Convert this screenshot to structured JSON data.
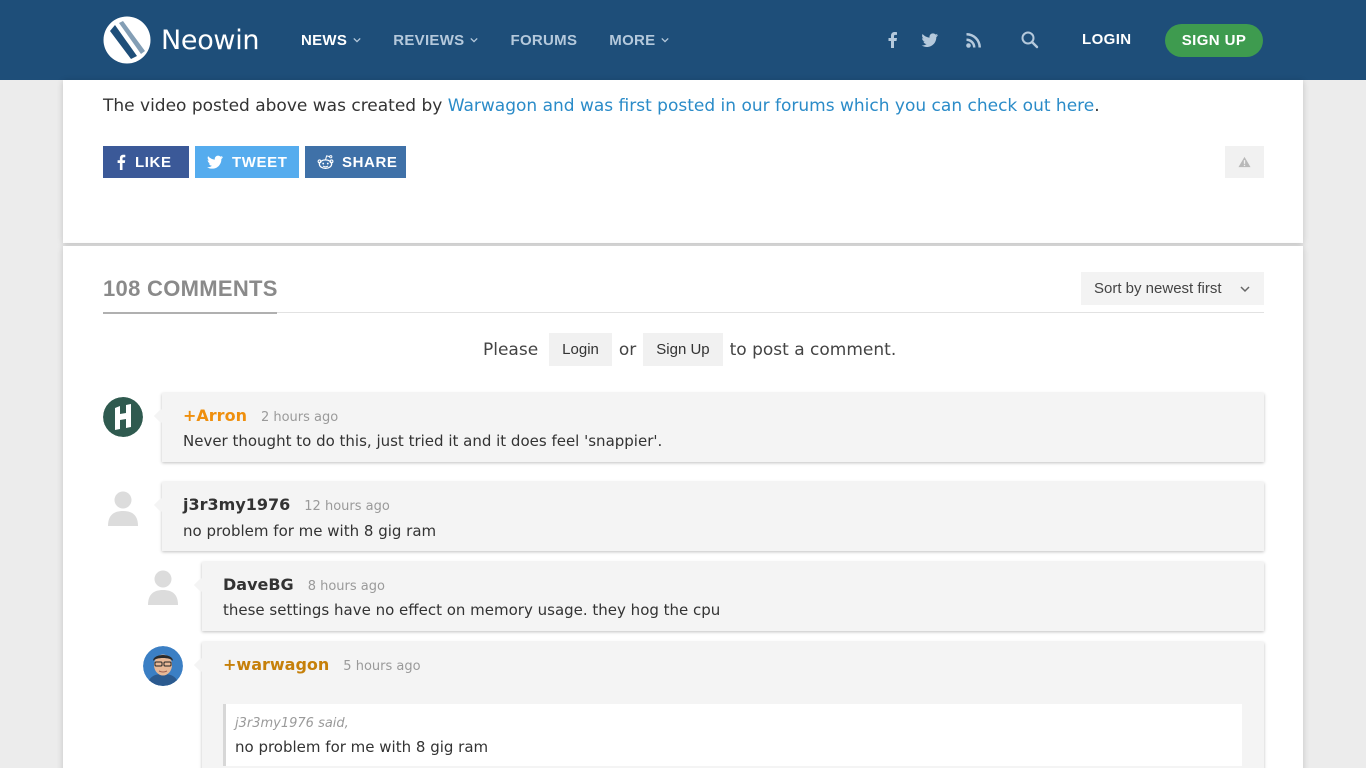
{
  "header": {
    "logo_text": "Neowin",
    "nav": [
      {
        "label": "NEWS",
        "active": true,
        "dropdown": true
      },
      {
        "label": "REVIEWS",
        "active": false,
        "dropdown": true
      },
      {
        "label": "FORUMS",
        "active": false,
        "dropdown": false
      },
      {
        "label": "MORE",
        "active": false,
        "dropdown": true
      }
    ],
    "social_icons": [
      "facebook-icon",
      "twitter-icon",
      "rss-icon",
      "search-icon"
    ],
    "login_label": "LOGIN",
    "signup_label": "SIGN UP"
  },
  "article": {
    "intro_text": "The video posted above was created by ",
    "link_text": "Warwagon and was first posted in our forums which you can check out here",
    "end_text": ".",
    "share_buttons": {
      "like": "LIKE",
      "tweet": "TWEET",
      "share": "SHARE"
    }
  },
  "comments": {
    "title": "108 COMMENTS",
    "sort_label": "Sort by newest first",
    "prompt": {
      "before": "Please",
      "login": "Login",
      "or": "or",
      "signup": "Sign Up",
      "after": "to post a comment."
    },
    "items": [
      {
        "author": "+Arron",
        "time": "2 hours ago",
        "body": "Never thought to do this, just tried it and it does feel 'snappier'."
      },
      {
        "author": "j3r3my1976",
        "time": "12 hours ago",
        "body": "no problem for me with 8 gig ram"
      },
      {
        "author": "DaveBG",
        "time": "8 hours ago",
        "body": "these settings have no effect on memory usage. they hog the cpu"
      },
      {
        "author": "+warwagon",
        "time": "5 hours ago",
        "quote_author": "j3r3my1976 said,",
        "quote_text": "no problem for me with 8 gig ram"
      }
    ]
  },
  "colors": {
    "header_bg": "#1e4e79",
    "signup_green": "#3e9b4f",
    "link_blue": "#2a8bc8",
    "author_orange": "#ef8f0d",
    "facebook": "#3b5998",
    "twitter": "#55acee",
    "reddit": "#3f71a8"
  }
}
